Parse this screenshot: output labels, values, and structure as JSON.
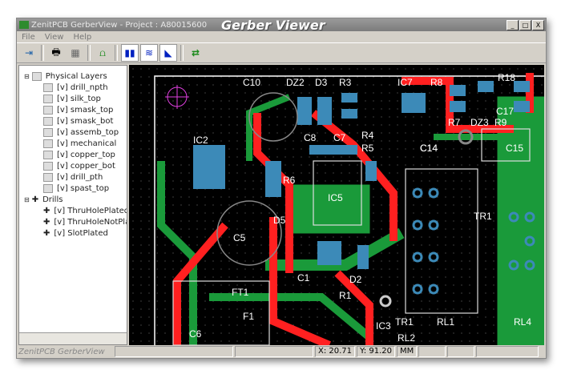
{
  "window": {
    "title": "ZenitPCB GerberView - Project : A80015600",
    "overlay_title": "Gerber Viewer",
    "controls": [
      "_",
      "□",
      "X"
    ]
  },
  "menu": [
    "File",
    "View",
    "Help"
  ],
  "toolbar": [
    "exit-icon",
    "print-icon",
    "grid-icon",
    "layers-icon",
    "pause-icon",
    "tracks-icon",
    "fill-icon",
    "swap-icon"
  ],
  "tree": {
    "physical_layers": {
      "label": "Physical Layers",
      "items": [
        "[v] drill_npth",
        "[v] silk_top",
        "[v] smask_top",
        "[v] smask_bot",
        "[v] assemb_top",
        "[v] mechanical",
        "[v] copper_top",
        "[v] copper_bot",
        "[v] drill_pth",
        "[v] spast_top"
      ]
    },
    "drills": {
      "label": "Drills",
      "items": [
        "[v] ThruHolePlated",
        "[v] ThruHoleNotPlated",
        "[v] SlotPlated"
      ]
    }
  },
  "pcb_labels": [
    "C10",
    "DZ2",
    "D3",
    "R3",
    "IC7",
    "R8",
    "R18",
    "IC2",
    "C8",
    "C7",
    "R4",
    "C14",
    "R7",
    "DZ3",
    "R9",
    "C15",
    "C17",
    "R6",
    "IC5",
    "D5",
    "C5",
    "TR1",
    "C1",
    "D2",
    "R1",
    "FT1",
    "F1",
    "C6",
    "IC3",
    "TR1",
    "RL1",
    "RL2",
    "RL4",
    "C14",
    "R5"
  ],
  "status": {
    "app": "ZenitPCB GerberView",
    "x": "X: 20.71",
    "y": "Y: 91.20",
    "units": "MM"
  },
  "colors": {
    "copper_top": "#ff2020",
    "copper_bot": "#1a9a3a",
    "pads": "#3c8ab8",
    "silk": "#ffffff",
    "background": "#000000"
  }
}
